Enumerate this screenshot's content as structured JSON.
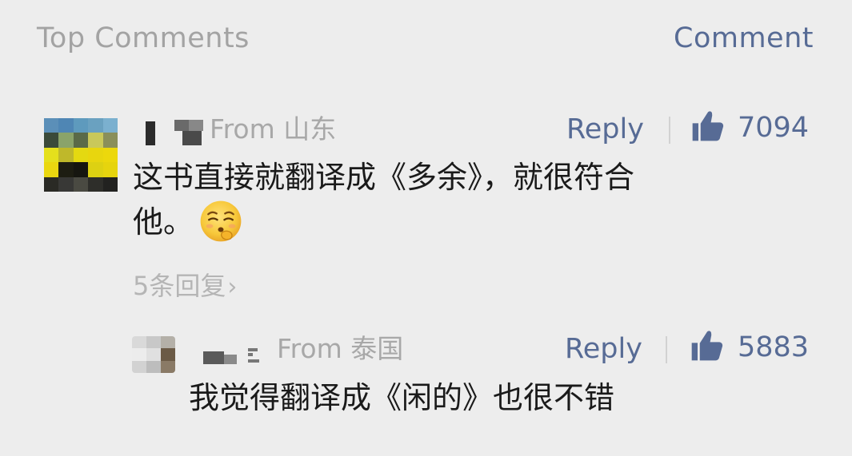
{
  "header": {
    "title": "Top Comments",
    "action_label": "Comment"
  },
  "comments": [
    {
      "location": "From 山东",
      "reply_label": "Reply",
      "likes": "7094",
      "text_line1": "这书直接就翻译成《多余》，就很符合",
      "text_line2": "他。",
      "emoji": "smirking-face-emoji",
      "replies_link": "5条回复",
      "replies_chevron": "›"
    }
  ],
  "replies": [
    {
      "location": "From 泰国",
      "reply_label": "Reply",
      "likes": "5883",
      "text": "我觉得翻译成《闲的》也很不错"
    }
  ],
  "colors": {
    "background": "#ededed",
    "link_blue": "#576b95",
    "muted_gray": "#a3a3a3",
    "text_dark": "#1a1a1a"
  },
  "icons": {
    "like": "thumbs-up-icon",
    "chevron": "chevron-right-icon"
  }
}
